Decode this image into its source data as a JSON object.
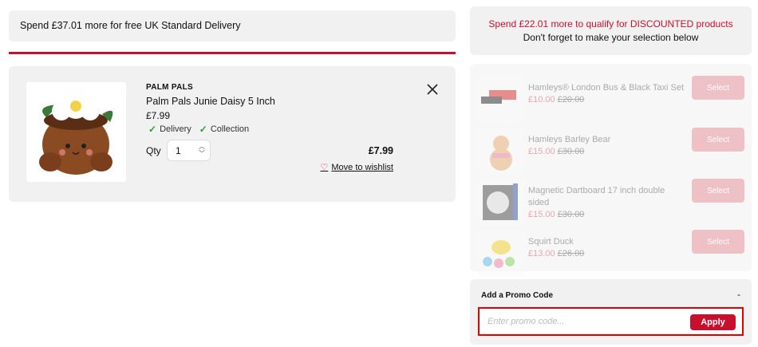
{
  "delivery_banner": {
    "text": "Spend £37.01 more for free UK Standard Delivery"
  },
  "cart_item": {
    "brand": "PALM PALS",
    "name": "Palm Pals Junie Daisy 5 Inch",
    "price": "£7.99",
    "availability": [
      "Delivery",
      "Collection"
    ],
    "qty_label": "Qty",
    "qty_value": "1",
    "line_total": "£7.99",
    "wishlist_label": "Move to wishlist",
    "icons": {
      "remove": "close-icon",
      "wishlist": "heart-icon",
      "available": "check-icon"
    }
  },
  "discount_banner": {
    "headline": "Spend £22.01 more to qualify for DISCOUNTED products",
    "subline": "Don't forget to make your selection below"
  },
  "offers": [
    {
      "title": "Hamleys® London Bus & Black Taxi Set",
      "price": "£10.00",
      "was": "£20.00",
      "button": "Select"
    },
    {
      "title": "Hamleys Barley Bear",
      "price": "£15.00",
      "was": "£30.00",
      "button": "Select"
    },
    {
      "title": "Magnetic Dartboard 17 inch double sided",
      "price": "£15.00",
      "was": "£30.00",
      "button": "Select"
    },
    {
      "title": "Squirt Duck",
      "price": "£13.00",
      "was": "£26.00",
      "button": "Select"
    }
  ],
  "promo": {
    "title": "Add a Promo Code",
    "toggle": "-",
    "placeholder": "Enter promo code...",
    "apply_label": "Apply"
  },
  "colors": {
    "accent": "#c8102e",
    "panel": "#f1f1f1",
    "check": "#2b9a3e"
  }
}
